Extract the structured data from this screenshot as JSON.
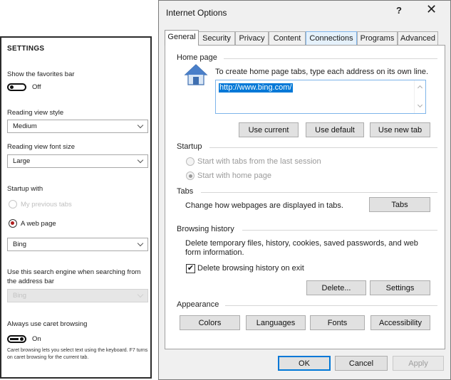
{
  "settings": {
    "title": "SETTINGS",
    "favorites_bar": {
      "label": "Show the favorites bar",
      "toggle_text": "Off"
    },
    "reading_style": {
      "label": "Reading view style",
      "value": "Medium"
    },
    "reading_font": {
      "label": "Reading view font size",
      "value": "Large"
    },
    "startup": {
      "label": "Startup with",
      "option_previous": "My previous tabs",
      "option_web_page": "A web page",
      "page_value": "Bing"
    },
    "search_engine": {
      "label": "Use this search engine when searching from the address bar",
      "value": "Bing"
    },
    "caret": {
      "label": "Always use caret browsing",
      "toggle_text": "On",
      "note": "Caret browsing lets you select text using the keyboard. F7 turns on caret browsing for the current tab."
    }
  },
  "dialog": {
    "title": "Internet Options",
    "help": "?",
    "close": "✕",
    "tabs": [
      "General",
      "Security",
      "Privacy",
      "Content",
      "Connections",
      "Programs",
      "Advanced"
    ],
    "home_page": {
      "heading": "Home page",
      "instruction": "To create home page tabs, type each address on its own line.",
      "url": "http://www.bing.com/",
      "use_current": "Use current",
      "use_default": "Use default",
      "use_new_tab": "Use new tab"
    },
    "startup": {
      "heading": "Startup",
      "option_last_session": "Start with tabs from the last session",
      "option_home_page": "Start with home page"
    },
    "tabs_section": {
      "heading": "Tabs",
      "description": "Change how webpages are displayed in tabs.",
      "button": "Tabs"
    },
    "browsing_history": {
      "heading": "Browsing history",
      "description": "Delete temporary files, history, cookies, saved passwords, and web form information.",
      "delete_on_exit": "Delete browsing history on exit",
      "delete_button": "Delete...",
      "settings_button": "Settings"
    },
    "appearance": {
      "heading": "Appearance",
      "colors": "Colors",
      "languages": "Languages",
      "fonts": "Fonts",
      "accessibility": "Accessibility"
    },
    "footer": {
      "ok": "OK",
      "cancel": "Cancel",
      "apply": "Apply"
    }
  }
}
